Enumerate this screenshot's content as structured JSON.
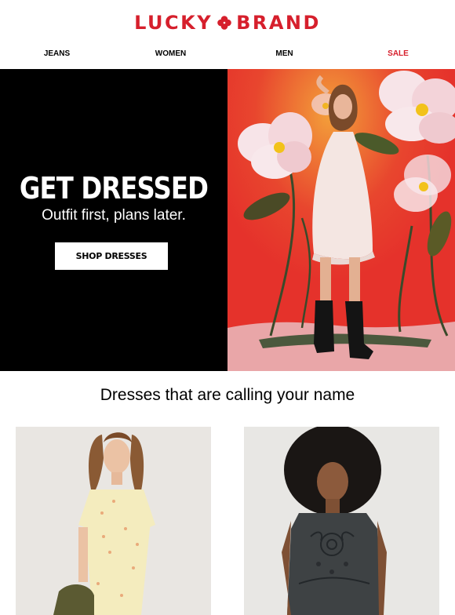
{
  "brand": {
    "name_left": "LUCKY",
    "name_right": "BRAND",
    "accent_color": "#d61f2c",
    "logo_icon": "clover-icon"
  },
  "nav": {
    "items": [
      {
        "label": "JEANS"
      },
      {
        "label": "WOMEN"
      },
      {
        "label": "MEN"
      },
      {
        "label": "SALE",
        "color": "#d61f2c"
      }
    ]
  },
  "hero": {
    "title": "GET DRESSED",
    "subtitle": "Outfit first, plans later.",
    "button_label": "SHOP DRESSES",
    "background_left": "#000000",
    "background_right": "#e8322c"
  },
  "section": {
    "title": "Dresses that are calling your name"
  },
  "products": [
    {
      "image": "woman-floral-dress-photo"
    },
    {
      "image": "woman-black-eyelet-dress-photo"
    }
  ]
}
